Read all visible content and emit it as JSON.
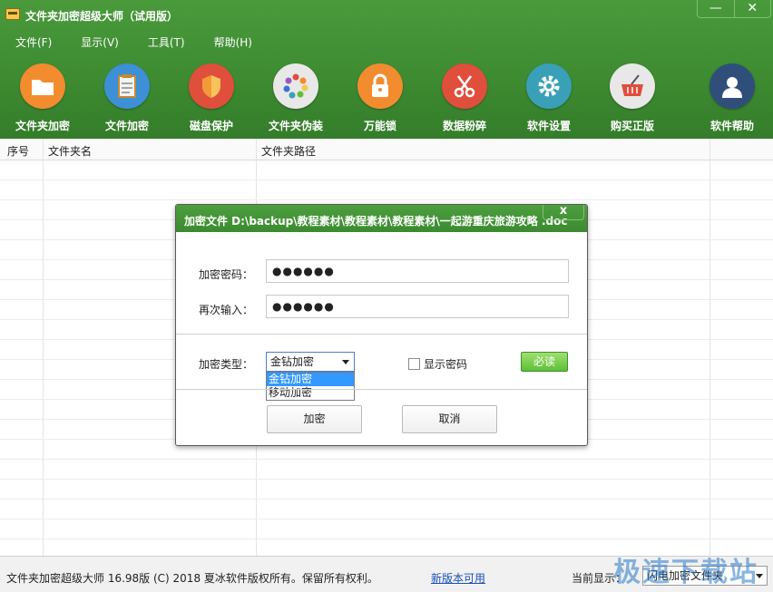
{
  "window": {
    "title": "文件夹加密超级大师（试用版）",
    "minimize_symbol": "—",
    "close_symbol": "✕"
  },
  "menu": [
    "文件(F)",
    "显示(V)",
    "工具(T)",
    "帮助(H)"
  ],
  "toolbar": [
    {
      "label": "文件夹加密",
      "icon": "folder-icon",
      "color": "#f28c2f"
    },
    {
      "label": "文件加密",
      "icon": "clipboard-icon",
      "color": "#3d8fd6"
    },
    {
      "label": "磁盘保护",
      "icon": "shield-icon",
      "color": "#e04e3c"
    },
    {
      "label": "文件夹伪装",
      "icon": "color-wheel-icon",
      "color": "#e8e8e8"
    },
    {
      "label": "万能锁",
      "icon": "padlock-icon",
      "color": "#f28c2f"
    },
    {
      "label": "数据粉碎",
      "icon": "scissors-icon",
      "color": "#e04e3c"
    },
    {
      "label": "软件设置",
      "icon": "gear-icon",
      "color": "#3aa0b8"
    },
    {
      "label": "购买正版",
      "icon": "basket-icon",
      "color": "#e8e8e8"
    },
    {
      "label": "软件帮助",
      "icon": "user-icon",
      "color": "#2f4f7a"
    }
  ],
  "table": {
    "columns": [
      "序号",
      "文件夹名",
      "文件夹路径"
    ]
  },
  "dialog": {
    "title": "加密文件 D:\\backup\\教程素材\\教程素材\\教程素材\\一起游重庆旅游攻略 .doc",
    "close_symbol": "x",
    "password_label": "加密密码：",
    "password_value": "●●●●●●",
    "confirm_label": "再次输入：",
    "confirm_value": "●●●●●●",
    "type_label": "加密类型：",
    "type_selected": "金钻加密",
    "type_options": [
      "金钻加密",
      "移动加密"
    ],
    "show_password_label": "显示密码",
    "required_button": "必读",
    "encrypt_button": "加密",
    "cancel_button": "取消"
  },
  "status": {
    "copyright": "文件夹加密超级大师 16.98版 (C) 2018  夏冰软件版权所有。保留所有权利。",
    "new_version_link": "新版本可用",
    "current_display_label": "当前显示：",
    "current_display_value": "闪电加密文件夹"
  },
  "watermark": "极速下载站"
}
